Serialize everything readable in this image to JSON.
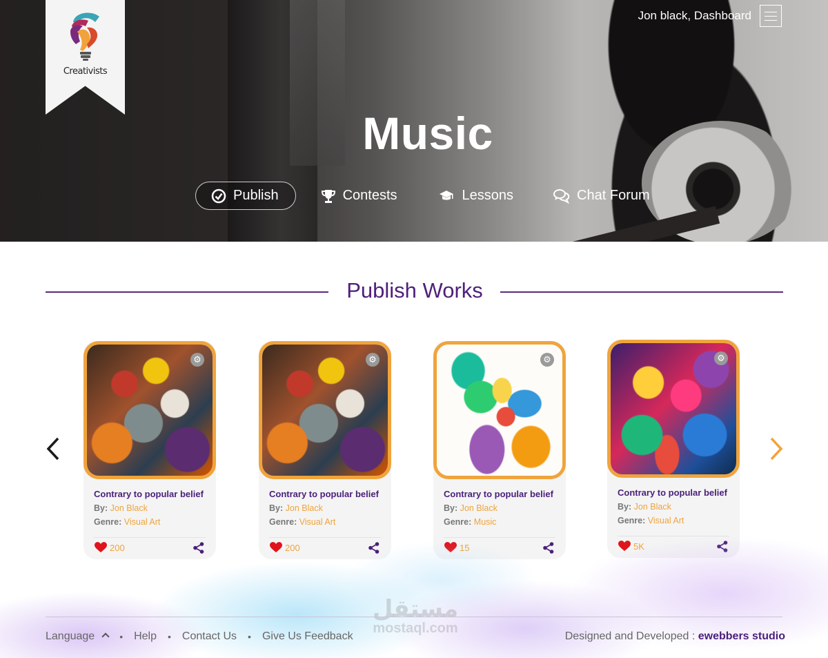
{
  "header": {
    "logo_text": "Creativists",
    "user_link": "Jon black, Dashboard",
    "title": "Music",
    "nav": [
      {
        "label": "Publish",
        "icon": "check-circle-icon",
        "active": true
      },
      {
        "label": "Contests",
        "icon": "trophy-icon",
        "active": false
      },
      {
        "label": "Lessons",
        "icon": "graduation-cap-icon",
        "active": false
      },
      {
        "label": "Chat Forum",
        "icon": "chat-bubbles-icon",
        "active": false
      }
    ]
  },
  "section": {
    "title": "Publish Works"
  },
  "cards": [
    {
      "title": "Contrary to popular belief",
      "by_label": "By:",
      "author": "Jon Black",
      "genre_label": "Genre:",
      "genre": "Visual Art",
      "likes": "200"
    },
    {
      "title": "Contrary to popular belief",
      "by_label": "By:",
      "author": "Jon Black",
      "genre_label": "Genre:",
      "genre": "Visual Art",
      "likes": "200"
    },
    {
      "title": "Contrary to popular belief",
      "by_label": "By:",
      "author": "Jon Black",
      "genre_label": "Genre:",
      "genre": "Music",
      "likes": "15"
    },
    {
      "title": "Contrary to popular belief",
      "by_label": "By:",
      "author": "Jon Black",
      "genre_label": "Genre:",
      "genre": "Visual Art",
      "likes": "5K"
    }
  ],
  "footer": {
    "language": "Language",
    "help": "Help",
    "contact": "Contact Us",
    "feedback": "Give Us Feedback",
    "credit_prefix": "Designed and Developed :",
    "credit_name": "ewebbers studio",
    "watermark_ar": "مستقل",
    "watermark_en": "mostaql.com"
  },
  "colors": {
    "brand_purple": "#4f1f7a",
    "accent_orange": "#f0a43c",
    "heart_red": "#e0141b"
  }
}
